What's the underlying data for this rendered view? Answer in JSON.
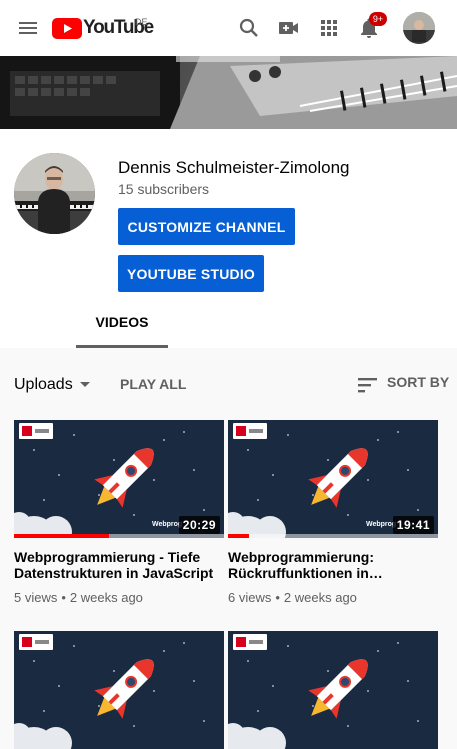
{
  "topbar": {
    "logo_text": "YouTube",
    "country_code": "DE",
    "notification_count": "9+",
    "icons": [
      "menu-icon",
      "search-icon",
      "create-video-icon",
      "apps-icon",
      "notifications-icon"
    ]
  },
  "channel": {
    "name": "Dennis Schulmeister-Zimolong",
    "subscribers": "15 subscribers",
    "customize_label": "CUSTOMIZE CHANNEL",
    "studio_label": "YOUTUBE STUDIO",
    "tabs": [
      {
        "label": "VIDEOS",
        "active": true
      }
    ]
  },
  "filters": {
    "uploads_label": "Uploads",
    "play_all_label": "PLAY ALL",
    "sort_label": "SORT BY"
  },
  "videos": [
    {
      "title": "Webprogrammierung - Tiefe Datenstrukturen in JavaScript",
      "duration": "20:29",
      "views": "5 views",
      "age": "2 weeks ago",
      "watched_fraction": 0.45
    },
    {
      "title": "Webprogrammierung: Rückruffunktionen in…",
      "duration": "19:41",
      "views": "6 views",
      "age": "2 weeks ago",
      "watched_fraction": 0.1
    },
    {
      "title": "",
      "duration": "",
      "views": "",
      "age": "",
      "watched_fraction": 0
    },
    {
      "title": "",
      "duration": "",
      "views": "",
      "age": "",
      "watched_fraction": 0
    }
  ],
  "thumbnail": {
    "caption_text": "Webprog",
    "colors": {
      "rocket_body": "#ffffff",
      "rocket_accent": "#e8362c",
      "flame": "#f7b731",
      "background": "#1a2a40"
    }
  },
  "colors": {
    "accent": "#065fd4",
    "brand_red": "#ff0000",
    "badge_red": "#cc0000"
  }
}
